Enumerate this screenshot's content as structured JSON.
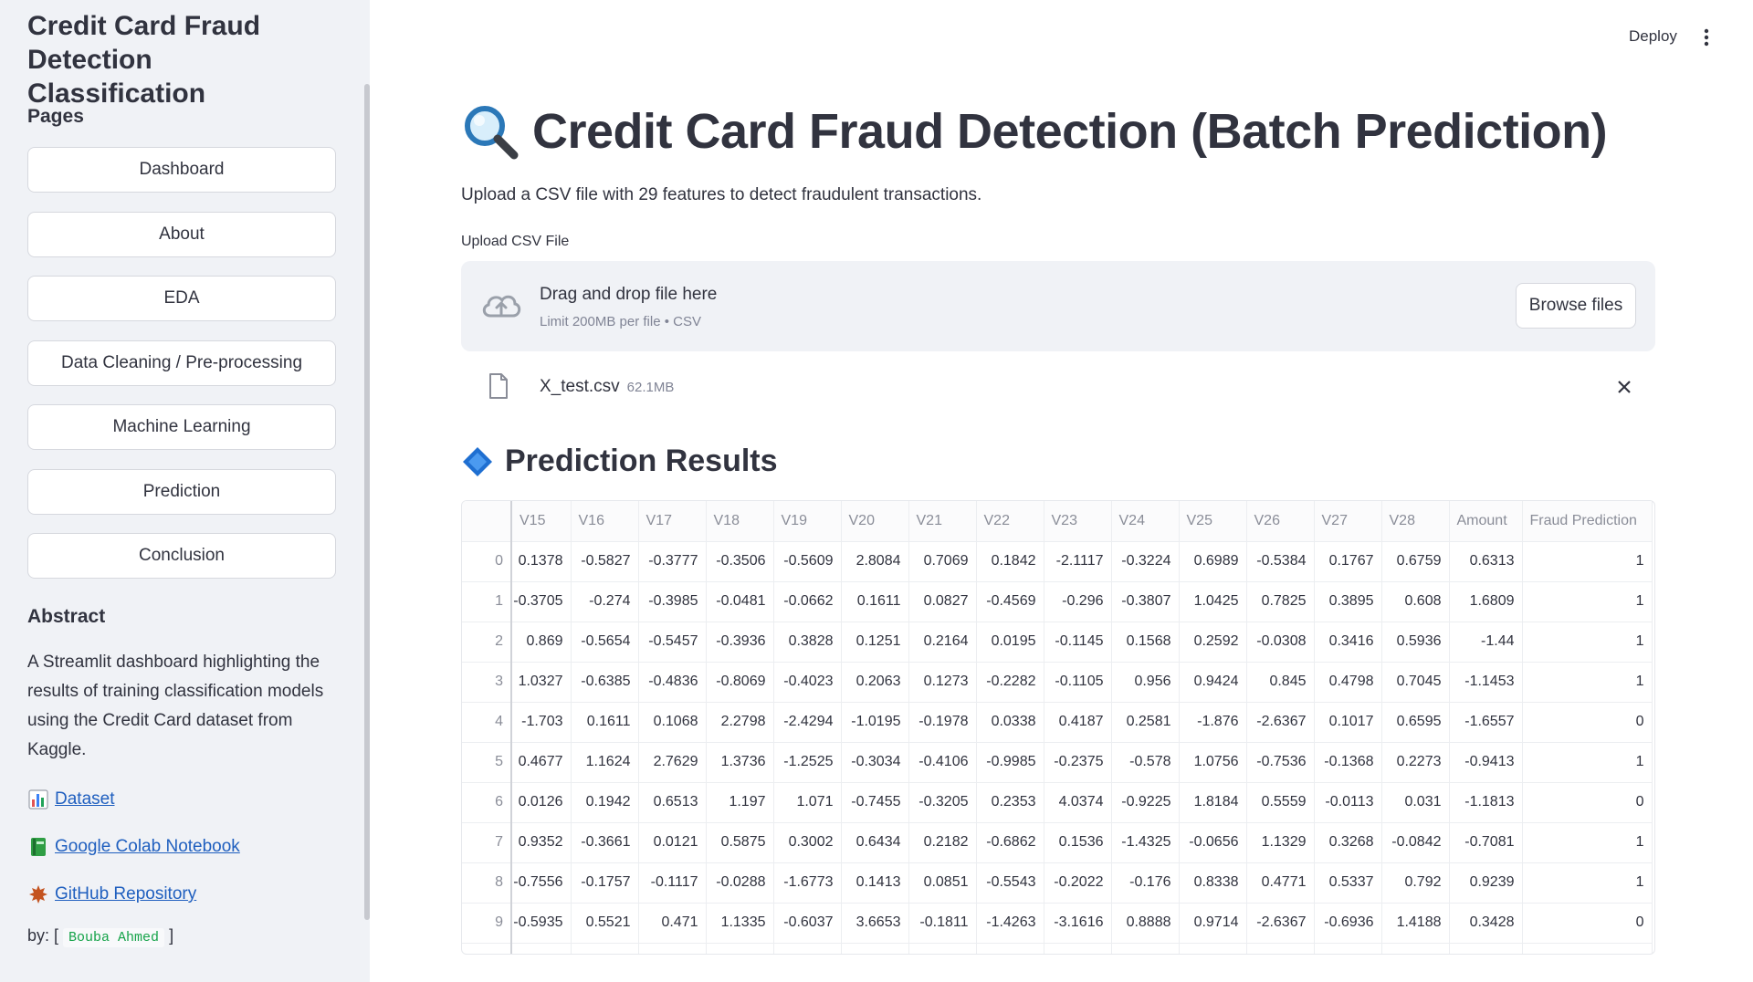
{
  "sidebar": {
    "app_title": "Credit Card Fraud Detection Classification",
    "pages_heading": "Pages",
    "nav": [
      "Dashboard",
      "About",
      "EDA",
      "Data Cleaning / Pre-processing",
      "Machine Learning",
      "Prediction",
      "Conclusion"
    ],
    "abstract_heading": "Abstract",
    "abstract_text": "A Streamlit dashboard highlighting the results of training classification models using the Credit Card dataset from Kaggle.",
    "links": [
      {
        "label": "Dataset",
        "icon": "bar-chart-icon"
      },
      {
        "label": "Google Colab Notebook",
        "icon": "green-book-icon"
      },
      {
        "label": "GitHub Repository",
        "icon": "maple-leaf-icon"
      }
    ],
    "by_label": "by: [",
    "by_close": "]",
    "author": "Bouba Ahmed"
  },
  "header": {
    "deploy_label": "Deploy",
    "menu_icon": "kebab-menu-icon"
  },
  "main": {
    "title": "Credit Card Fraud Detection (Batch Prediction)",
    "title_icon": "magnifier-icon",
    "description": "Upload a CSV file with 29 features to detect fraudulent transactions.",
    "upload_label": "Upload CSV File",
    "dropzone_title": "Drag and drop file here",
    "dropzone_sub": "Limit 200MB per file • CSV",
    "browse_label": "Browse files",
    "file_name": "X_test.csv",
    "file_size": "62.1MB",
    "results_title": "Prediction Results",
    "results_icon": "blue-diamond-icon"
  },
  "table": {
    "columns": [
      "V15",
      "V16",
      "V17",
      "V18",
      "V19",
      "V20",
      "V21",
      "V22",
      "V23",
      "V24",
      "V25",
      "V26",
      "V27",
      "V28",
      "Amount",
      "Fraud Prediction"
    ],
    "rows": [
      {
        "index": "0",
        "cells": [
          "0.1378",
          "-0.5827",
          "-0.3777",
          "-0.3506",
          "-0.5609",
          "2.8084",
          "0.7069",
          "0.1842",
          "-2.1117",
          "-0.3224",
          "0.6989",
          "-0.5384",
          "0.1767",
          "0.6759",
          "0.6313",
          "1"
        ]
      },
      {
        "index": "1",
        "cells": [
          "-0.3705",
          "-0.274",
          "-0.3985",
          "-0.0481",
          "-0.0662",
          "0.1611",
          "0.0827",
          "-0.4569",
          "-0.296",
          "-0.3807",
          "1.0425",
          "0.7825",
          "0.3895",
          "0.608",
          "1.6809",
          "1"
        ]
      },
      {
        "index": "2",
        "cells": [
          "0.869",
          "-0.5654",
          "-0.5457",
          "-0.3936",
          "0.3828",
          "0.1251",
          "0.2164",
          "0.0195",
          "-0.1145",
          "0.1568",
          "0.2592",
          "-0.0308",
          "0.3416",
          "0.5936",
          "-1.44",
          "1"
        ]
      },
      {
        "index": "3",
        "cells": [
          "1.0327",
          "-0.6385",
          "-0.4836",
          "-0.8069",
          "-0.4023",
          "0.2063",
          "0.1273",
          "-0.2282",
          "-0.1105",
          "0.956",
          "0.9424",
          "0.845",
          "0.4798",
          "0.7045",
          "-1.1453",
          "1"
        ]
      },
      {
        "index": "4",
        "cells": [
          "-1.703",
          "0.1611",
          "0.1068",
          "2.2798",
          "-2.4294",
          "-1.0195",
          "-0.1978",
          "0.0338",
          "0.4187",
          "0.2581",
          "-1.876",
          "-2.6367",
          "0.1017",
          "0.6595",
          "-1.6557",
          "0"
        ]
      },
      {
        "index": "5",
        "cells": [
          "0.4677",
          "1.1624",
          "2.7629",
          "1.3736",
          "-1.2525",
          "-0.3034",
          "-0.4106",
          "-0.9985",
          "-0.2375",
          "-0.578",
          "1.0756",
          "-0.7536",
          "-0.1368",
          "0.2273",
          "-0.9413",
          "1"
        ]
      },
      {
        "index": "6",
        "cells": [
          "0.0126",
          "0.1942",
          "0.6513",
          "1.197",
          "1.071",
          "-0.7455",
          "-0.3205",
          "0.2353",
          "4.0374",
          "-0.9225",
          "1.8184",
          "0.5559",
          "-0.0113",
          "0.031",
          "-1.1813",
          "0"
        ]
      },
      {
        "index": "7",
        "cells": [
          "0.9352",
          "-0.3661",
          "0.0121",
          "0.5875",
          "0.3002",
          "0.6434",
          "0.2182",
          "-0.6862",
          "0.1536",
          "-1.4325",
          "-0.0656",
          "1.1329",
          "0.3268",
          "-0.0842",
          "-0.7081",
          "1"
        ]
      },
      {
        "index": "8",
        "cells": [
          "-0.7556",
          "-0.1757",
          "-0.1117",
          "-0.0288",
          "-1.6773",
          "0.1413",
          "0.0851",
          "-0.5543",
          "-0.2022",
          "-0.176",
          "0.8338",
          "0.4771",
          "0.5337",
          "0.792",
          "0.9239",
          "1"
        ]
      },
      {
        "index": "9",
        "cells": [
          "-0.5935",
          "0.5521",
          "0.471",
          "1.1335",
          "-0.6037",
          "3.6653",
          "-0.1811",
          "-1.4263",
          "-3.1616",
          "0.8888",
          "0.9714",
          "-2.6367",
          "-0.6936",
          "1.4188",
          "0.3428",
          "0"
        ]
      }
    ]
  }
}
